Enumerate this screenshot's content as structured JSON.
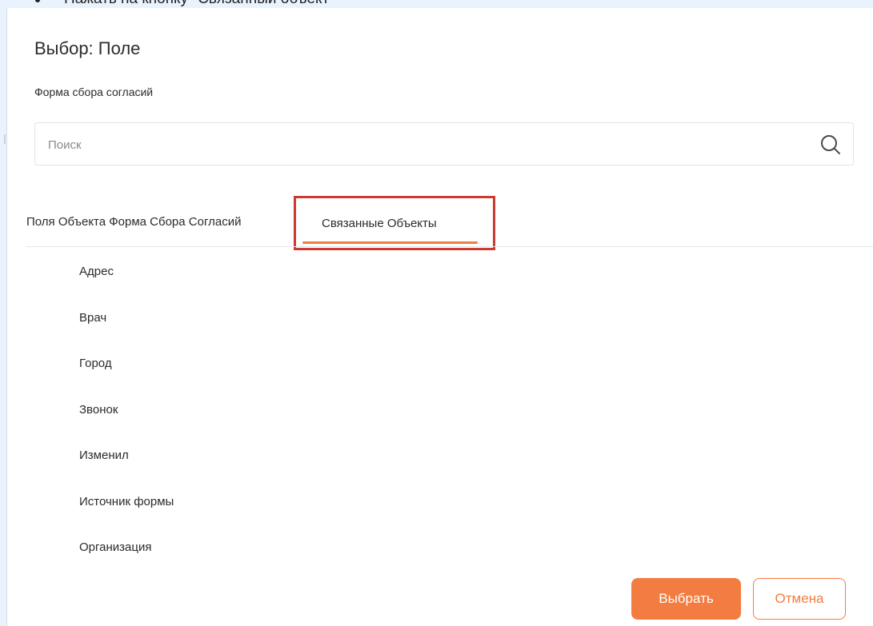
{
  "background_instruction": "Нажать на кнопку \"Связанный объект\"",
  "dialog": {
    "title": "Выбор: Поле",
    "subtitle": "Форма сбора согласий"
  },
  "search": {
    "placeholder": "Поиск",
    "value": ""
  },
  "tabs": [
    {
      "label": "Поля Объекта Форма Сбора Согласий",
      "active": false
    },
    {
      "label": "Связанные Объекты",
      "active": true
    }
  ],
  "fields": [
    {
      "label": "Адрес"
    },
    {
      "label": "Врач"
    },
    {
      "label": "Город"
    },
    {
      "label": "Звонок"
    },
    {
      "label": "Изменил"
    },
    {
      "label": "Источник формы"
    },
    {
      "label": "Организация"
    }
  ],
  "actions": {
    "select_label": "Выбрать",
    "cancel_label": "Отмена"
  },
  "colors": {
    "accent": "#f37c40",
    "highlight": "#cc3b2f"
  },
  "icons": {
    "search": "search-icon"
  }
}
